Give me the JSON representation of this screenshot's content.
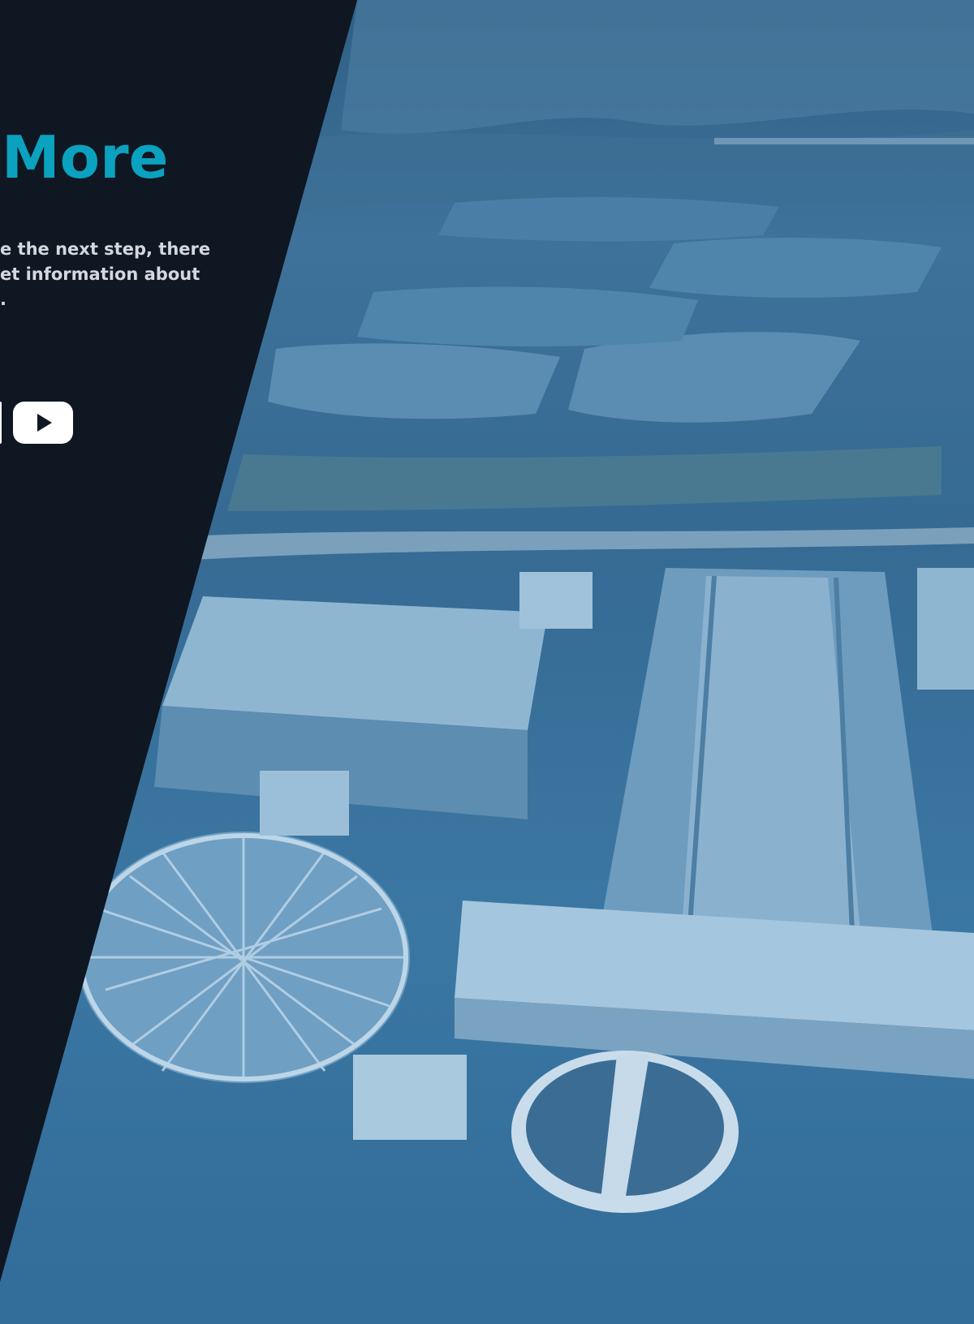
{
  "section": {
    "heading": "More",
    "body_lines": [
      "e the next step, there",
      "et information about",
      "."
    ]
  },
  "social": {
    "partial_icon": "social-icon",
    "youtube_icon": "youtube-play-icon"
  },
  "colors": {
    "panel_bg": "#0f1722",
    "heading": "#0aa2bf",
    "body_text": "#d4d8de",
    "photo_tint": "#3b77a3",
    "button_bg": "#ffffff"
  }
}
